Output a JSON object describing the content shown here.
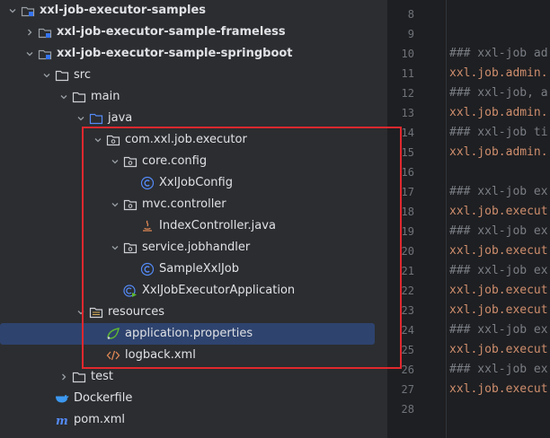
{
  "project_tree": {
    "items": [
      {
        "label": "xxl-job-executor-samples",
        "bold": true,
        "chevron": "down",
        "icon": "module-folder-icon"
      },
      {
        "label": "xxl-job-executor-sample-frameless",
        "bold": true,
        "chevron": "right",
        "icon": "module-folder-icon"
      },
      {
        "label": "xxl-job-executor-sample-springboot",
        "bold": true,
        "chevron": "down",
        "icon": "module-folder-icon"
      },
      {
        "label": "src",
        "bold": false,
        "chevron": "down",
        "icon": "folder-icon"
      },
      {
        "label": "main",
        "bold": false,
        "chevron": "down",
        "icon": "folder-icon"
      },
      {
        "label": "java",
        "bold": false,
        "chevron": "down",
        "icon": "source-folder-icon"
      },
      {
        "label": "com.xxl.job.executor",
        "bold": false,
        "chevron": "down",
        "icon": "package-icon"
      },
      {
        "label": "core.config",
        "bold": false,
        "chevron": "down",
        "icon": "package-icon"
      },
      {
        "label": "XxlJobConfig",
        "bold": false,
        "chevron": "",
        "icon": "class-icon"
      },
      {
        "label": "mvc.controller",
        "bold": false,
        "chevron": "down",
        "icon": "package-icon"
      },
      {
        "label": "IndexController.java",
        "bold": false,
        "chevron": "",
        "icon": "java-file-icon"
      },
      {
        "label": "service.jobhandler",
        "bold": false,
        "chevron": "down",
        "icon": "package-icon"
      },
      {
        "label": "SampleXxlJob",
        "bold": false,
        "chevron": "",
        "icon": "class-icon"
      },
      {
        "label": "XxlJobExecutorApplication",
        "bold": false,
        "chevron": "",
        "icon": "springboot-app-icon"
      },
      {
        "label": "resources",
        "bold": false,
        "chevron": "down",
        "icon": "resources-folder-icon"
      },
      {
        "label": "application.properties",
        "bold": false,
        "chevron": "",
        "icon": "spring-properties-icon",
        "selected": true
      },
      {
        "label": "logback.xml",
        "bold": false,
        "chevron": "",
        "icon": "xml-file-icon"
      },
      {
        "label": "test",
        "bold": false,
        "chevron": "right",
        "icon": "folder-icon"
      },
      {
        "label": "Dockerfile",
        "bold": false,
        "chevron": "",
        "icon": "docker-icon"
      },
      {
        "label": "pom.xml",
        "bold": false,
        "chevron": "",
        "icon": "maven-icon"
      }
    ]
  },
  "gutter": {
    "line_numbers": [
      "8",
      "9",
      "10",
      "11",
      "12",
      "13",
      "14",
      "15",
      "16",
      "17",
      "18",
      "19",
      "20",
      "21",
      "22",
      "23",
      "24",
      "25",
      "26",
      "27",
      "28"
    ]
  },
  "editor": {
    "lines": [
      {
        "text": "",
        "kind": "plain"
      },
      {
        "text": "",
        "kind": "plain"
      },
      {
        "text": "### xxl-job ad",
        "kind": "comment"
      },
      {
        "text": "xxl.job.admin.",
        "kind": "key"
      },
      {
        "text": "### xxl-job, a",
        "kind": "comment"
      },
      {
        "text": "xxl.job.admin.",
        "kind": "key"
      },
      {
        "text": "### xxl-job ti",
        "kind": "comment"
      },
      {
        "text": "xxl.job.admin.",
        "kind": "key"
      },
      {
        "text": "",
        "kind": "plain"
      },
      {
        "text": "### xxl-job ex",
        "kind": "comment"
      },
      {
        "text": "xxl.job.execut",
        "kind": "key"
      },
      {
        "text": "### xxl-job ex",
        "kind": "comment"
      },
      {
        "text": "xxl.job.execut",
        "kind": "key"
      },
      {
        "text": "### xxl-job ex",
        "kind": "comment"
      },
      {
        "text": "xxl.job.execut",
        "kind": "key"
      },
      {
        "text": "xxl.job.execut",
        "kind": "key"
      },
      {
        "text": "### xxl-job ex",
        "kind": "comment"
      },
      {
        "text": "xxl.job.execut",
        "kind": "key"
      },
      {
        "text": "### xxl-job ex",
        "kind": "comment"
      },
      {
        "text": "xxl.job.execut",
        "kind": "key"
      },
      {
        "text": "",
        "kind": "plain"
      }
    ]
  },
  "colors": {
    "highlight_box": "#e0282e",
    "selection": "#2e436e",
    "comment": "#7a7e85",
    "property_key": "#cf8e6d"
  }
}
